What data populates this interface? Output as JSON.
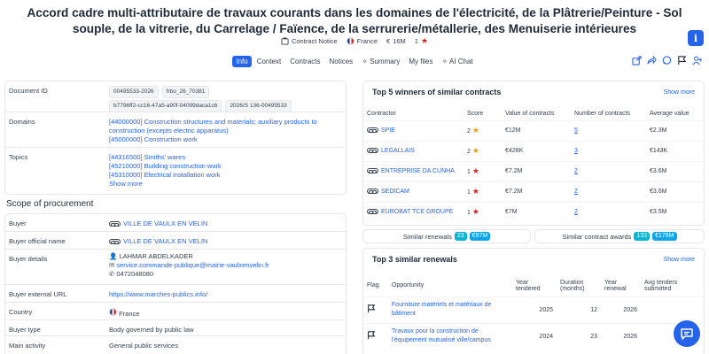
{
  "title": "Accord cadre multi-attributaire de travaux courants dans les domaines de l'électricité, de la Plâtrerie/Peinture - Sol souple, de la vitrerie, du Carrelage / Faïence, de la serrurerie/métallerie, des Menuiserie intérieures",
  "meta": {
    "notice": "Contract Notice",
    "country": "France",
    "value": "16M",
    "rank": "1"
  },
  "tabs": [
    "Info",
    "Context",
    "Contracts",
    "Notices",
    "Summary",
    "My files",
    "AI Chat"
  ],
  "details": {
    "document_id": {
      "label": "Document ID",
      "ids": [
        "00495533-2026",
        "frbo_26_70381",
        "b7796ff2-cc16-47a5-a90f-04099daca1cb",
        "2026/S 136-00495533"
      ]
    },
    "domains": {
      "label": "Domains",
      "items": [
        "[44000000] Construction structures and materials; auxiliary products to construction (excepts electric apparatus)",
        "[45000000] Construction work"
      ]
    },
    "topics": {
      "label": "Topics",
      "items": [
        "[44316500] Smiths' wares",
        "[45210000] Building construction work",
        "[45310000] Electrical installation work"
      ],
      "more": "Show more"
    }
  },
  "scope": {
    "title": "Scope of procurement",
    "buyer": {
      "label": "Buyer",
      "value": "VILLE DE VAULX EN VELIN"
    },
    "buyer_official": {
      "label": "Buyer official name",
      "value": "VILLE DE VAULX EN VELIN"
    },
    "buyer_details": {
      "label": "Buyer details",
      "person": "LAHMAR ABDELKADER",
      "email": "service.commande-publique@mairie-vaulxenvelin.fr",
      "phone": "0472048080"
    },
    "buyer_url": {
      "label": "Buyer external URL",
      "value": "https://www.marches-publics.info/"
    },
    "country": {
      "label": "Country",
      "value": "France"
    },
    "buyer_type": {
      "label": "Buyer type",
      "value": "Body governed by public law"
    },
    "main_activity": {
      "label": "Main activity",
      "value": "General public services"
    }
  },
  "winners": {
    "title": "Top 5 winners of similar contracts",
    "more": "Show more",
    "headers": [
      "Contractor",
      "Score",
      "Value of contracts",
      "Number of contracts",
      "Average value"
    ],
    "rows": [
      {
        "name": "SPIE",
        "score": "2",
        "value": "€12M",
        "count": "5",
        "avg": "€2.3M",
        "star": "orange"
      },
      {
        "name": "LEGALLAIS",
        "score": "2",
        "value": "€428K",
        "count": "3",
        "avg": "€143K",
        "star": "orange"
      },
      {
        "name": "ENTREPRISE DA CUNHA",
        "score": "1",
        "value": "€7.2M",
        "count": "2",
        "avg": "€3.6M",
        "star": "red"
      },
      {
        "name": "SEDICAM",
        "score": "1",
        "value": "€7.2M",
        "count": "2",
        "avg": "€3.6M",
        "star": "red"
      },
      {
        "name": "EUROBAT TCE GROUPE",
        "score": "1",
        "value": "€7M",
        "count": "2",
        "avg": "€3.5M",
        "star": "red"
      }
    ]
  },
  "similar": {
    "renewals_label": "Similar renewals",
    "renewals_count": "23",
    "renewals_value": "€97M",
    "awards_label": "Similar contract awards",
    "awards_count": "133",
    "awards_value": "€176M"
  },
  "renewals": {
    "title": "Top 3 similar renewals",
    "more": "Show more",
    "headers": [
      "Flag",
      "Opportunity",
      "Year tendered",
      "Duration (months)",
      "Year renewal",
      "Avg tenders submitted"
    ],
    "rows": [
      {
        "opportunity": "Fourniture matériels et matériaux de bâtiment",
        "year": "2025",
        "duration": "12",
        "renewal": "2026"
      },
      {
        "opportunity": "Travaux pour la construction de l'équipement mutualisé ville/campus",
        "year": "2024",
        "duration": "23",
        "renewal": "2026"
      }
    ]
  },
  "colors": {
    "accent": "#2563eb",
    "badge": "#06b6d4"
  }
}
